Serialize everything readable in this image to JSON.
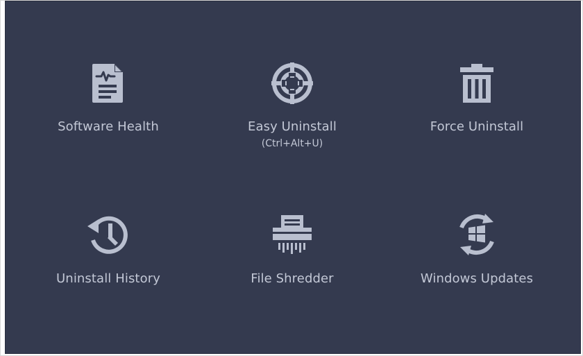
{
  "colors": {
    "panel_background": "#343a4f",
    "icon_color": "#b9bfcf",
    "text_color": "#c3c8d6"
  },
  "tools": [
    {
      "label": "Software Health",
      "sublabel": "",
      "icon": "document-heartbeat-icon"
    },
    {
      "label": "Easy Uninstall",
      "sublabel": "(Ctrl+Alt+U)",
      "icon": "crosshair-target-icon"
    },
    {
      "label": "Force Uninstall",
      "sublabel": "",
      "icon": "trash-can-icon"
    },
    {
      "label": "Uninstall History",
      "sublabel": "",
      "icon": "history-clock-icon"
    },
    {
      "label": "File Shredder",
      "sublabel": "",
      "icon": "shredder-icon"
    },
    {
      "label": "Windows Updates",
      "sublabel": "",
      "icon": "windows-update-icon"
    }
  ]
}
